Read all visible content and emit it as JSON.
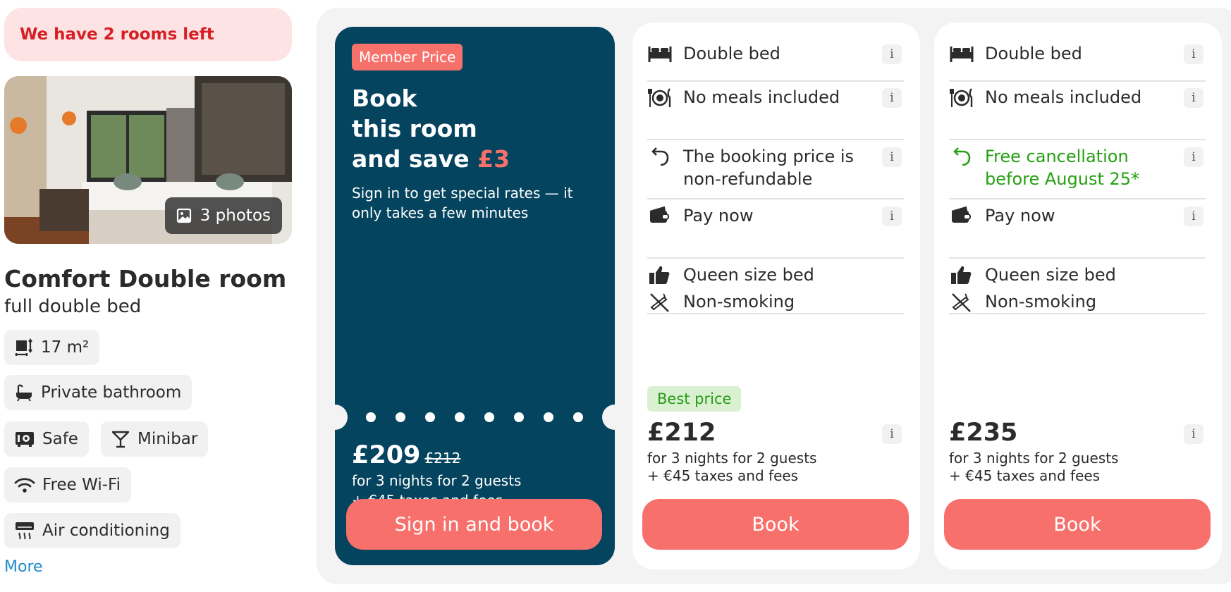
{
  "alert": "We have 2 rooms left",
  "photos_button": "3 photos",
  "room": {
    "title": "Comfort Double room",
    "subtitle": "full double bed"
  },
  "amenities": [
    "17 m²",
    "Private bathroom",
    "Safe",
    "Minibar",
    "Free Wi-Fi",
    "Air conditioning"
  ],
  "more_link": "More",
  "member": {
    "badge": "Member Price",
    "headline_1": "Book",
    "headline_2": "this room",
    "headline_3": "and save",
    "save_amount": "£3",
    "description": "Sign in to get special rates — it only takes a few minutes",
    "price": "£209",
    "old_price": "£212",
    "nights": "for 3 nights for 2 guests",
    "taxes": "+ €45 taxes and fees",
    "button": "Sign in and book"
  },
  "options": [
    {
      "bed": "Double bed",
      "meals": "No meals included",
      "cancellation": "The booking price is non-refundable",
      "payment": "Pay now",
      "perk_1": "Queen size bed",
      "perk_2": "Non-smoking",
      "badge": "Best price",
      "price": "£212",
      "nights": "for 3 nights for 2 guests",
      "taxes": "+ €45 taxes and fees",
      "button": "Book"
    },
    {
      "bed": "Double bed",
      "meals": "No meals included",
      "cancellation": "Free cancellation before August 25*",
      "payment": "Pay now",
      "perk_1": "Queen size bed",
      "perk_2": "Non-smoking",
      "price": "£235",
      "nights": "for 3 nights for 2 guests",
      "taxes": "+ €45 taxes and fees",
      "button": "Book"
    }
  ],
  "info_label": "i",
  "colors": {
    "accent": "#f7706b",
    "member_bg": "#05445e",
    "alert_text": "#d61f25",
    "green": "#25a012"
  }
}
